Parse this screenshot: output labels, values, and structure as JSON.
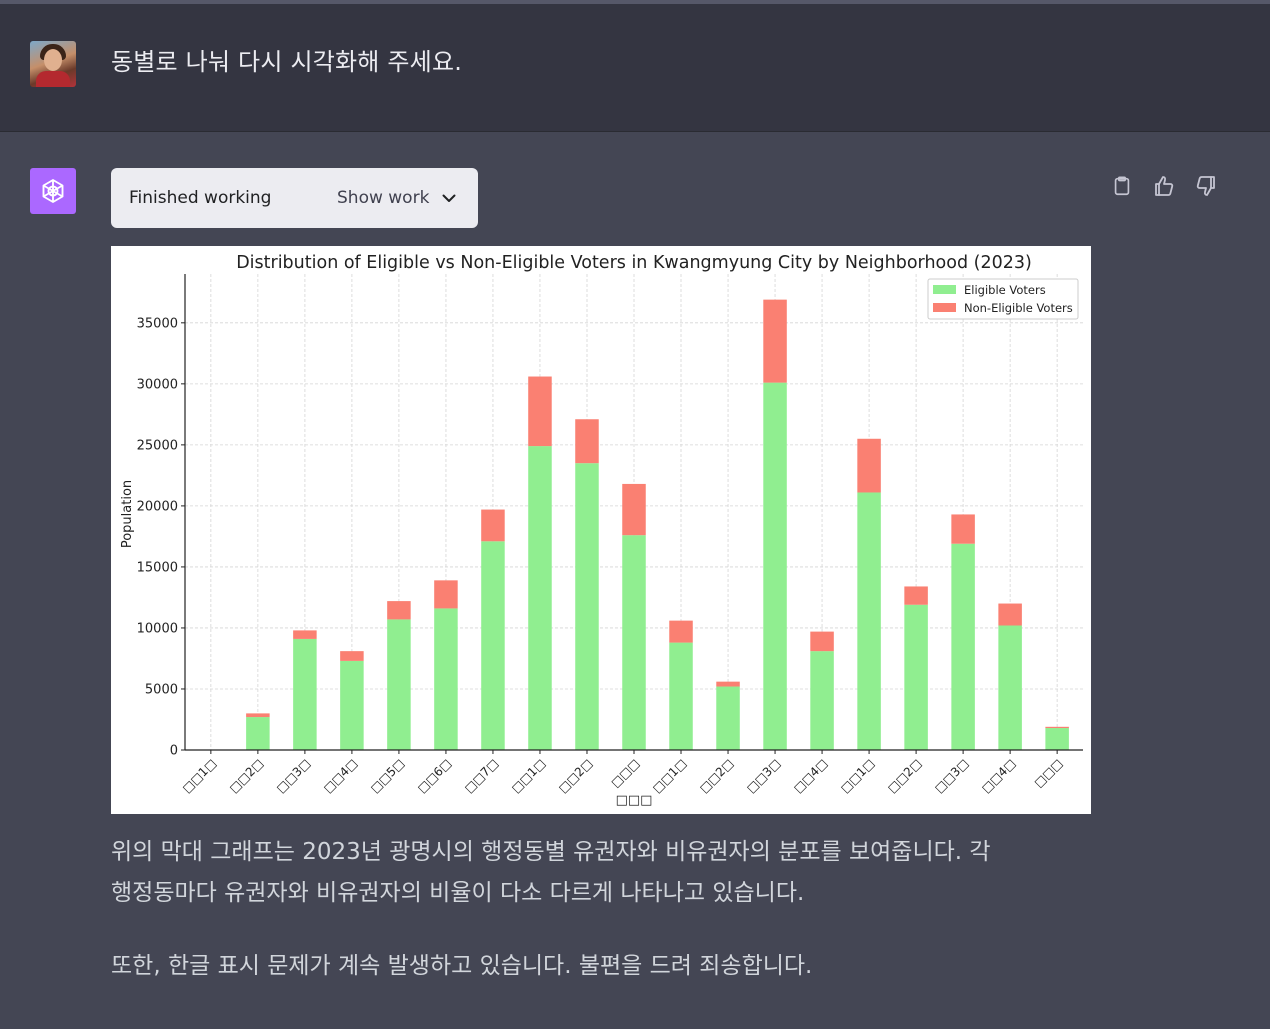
{
  "user_message": {
    "text": "동별로 나눠 다시 시각화해 주세요."
  },
  "assistant": {
    "work_status": "Finished working",
    "show_work_label": "Show work",
    "paragraph_1_line_1": "위의 막대 그래프는 2023년 광명시의 행정동별 유권자와 비유권자의 분포를 보여줍니다. 각",
    "paragraph_1_line_2": "행정동마다 유권자와 비유권자의 비율이 다소 다르게 나타나고 있습니다.",
    "paragraph_2": "또한, 한글 표시 문제가 계속 발생하고 있습니다. 불편을 드려 죄송합니다."
  },
  "icons": {
    "clipboard": "clipboard-icon",
    "thumbs_up": "thumbs-up-icon",
    "thumbs_down": "thumbs-down-icon",
    "openai_logo": "openai-logo-icon",
    "chevron": "chevron-down-icon"
  },
  "colors": {
    "eligible": "#90ee90",
    "non_eligible": "#fa8072",
    "app_bg": "#444654",
    "user_bg": "#343541",
    "gpt_brand": "#ab68ff"
  },
  "chart_data": {
    "type": "bar",
    "stacked": true,
    "title": "Distribution of Eligible vs Non-Eligible Voters in Kwangmyung City by Neighborhood (2023)",
    "xlabel": "□□□",
    "ylabel": "Population",
    "ylim": [
      0,
      39000
    ],
    "yticks": [
      "0",
      "5000",
      "10000",
      "15000",
      "20000",
      "25000",
      "30000",
      "35000"
    ],
    "grid": true,
    "legend_position": "top-right",
    "categories": [
      "□□1□",
      "□□2□",
      "□□3□",
      "□□4□",
      "□□5□",
      "□□6□",
      "□□7□",
      "□□1□",
      "□□2□",
      "□□□",
      "□□1□",
      "□□2□",
      "□□3□",
      "□□4□",
      "□□1□",
      "□□2□",
      "□□3□",
      "□□4□",
      "□□□"
    ],
    "series": [
      {
        "name": "Eligible Voters",
        "color": "#90ee90",
        "values": [
          0,
          2700,
          9100,
          7300,
          10700,
          11600,
          17100,
          24900,
          23500,
          17600,
          8800,
          5200,
          30100,
          8100,
          21100,
          11900,
          16900,
          10200,
          1800
        ]
      },
      {
        "name": "Non-Eligible Voters",
        "color": "#fa8072",
        "values": [
          0,
          300,
          700,
          800,
          1500,
          2300,
          2600,
          5700,
          3600,
          4200,
          1800,
          400,
          6800,
          1600,
          4400,
          1500,
          2400,
          1800,
          100
        ]
      }
    ]
  }
}
